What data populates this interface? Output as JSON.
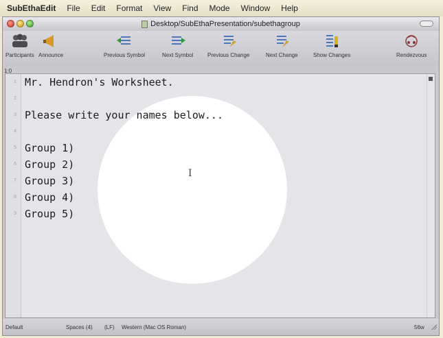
{
  "menubar": {
    "items": [
      "SubEthaEdit",
      "File",
      "Edit",
      "Format",
      "View",
      "Find",
      "Mode",
      "Window",
      "Help"
    ]
  },
  "window": {
    "title": "Desktop/SubEthaPresentation/subethagroup"
  },
  "toolbar": {
    "items": [
      {
        "label": "Participants",
        "icon": "participants-icon"
      },
      {
        "label": "Announce",
        "icon": "announce-icon"
      },
      {
        "label": "Previous Symbol",
        "icon": "previous-symbol-icon"
      },
      {
        "label": "Next Symbol",
        "icon": "next-symbol-icon"
      },
      {
        "label": "Previous Change",
        "icon": "previous-change-icon"
      },
      {
        "label": "Next Change",
        "icon": "next-change-icon"
      },
      {
        "label": "Show Changes",
        "icon": "show-changes-icon"
      },
      {
        "label": "Rendezvous",
        "icon": "rendezvous-icon"
      }
    ],
    "position": "1:0"
  },
  "editor": {
    "line_numbers": [
      "1",
      "2",
      "3",
      "4",
      "5",
      "6",
      "7",
      "8",
      "9"
    ],
    "lines": [
      "Mr. Hendron's Worksheet.",
      "",
      "Please write your names below...",
      "",
      "Group 1)",
      "Group 2)",
      "Group 3)",
      "Group 4)",
      "Group 5)"
    ]
  },
  "status": {
    "mode": "Default",
    "tab_settings": "Spaces (4)",
    "line_endings": "(LF)",
    "encoding": "Western (Mac OS Roman)",
    "word_count": "56w"
  },
  "colors": {
    "accent": "#3a7fc4",
    "spotlight": "#ffffff"
  }
}
